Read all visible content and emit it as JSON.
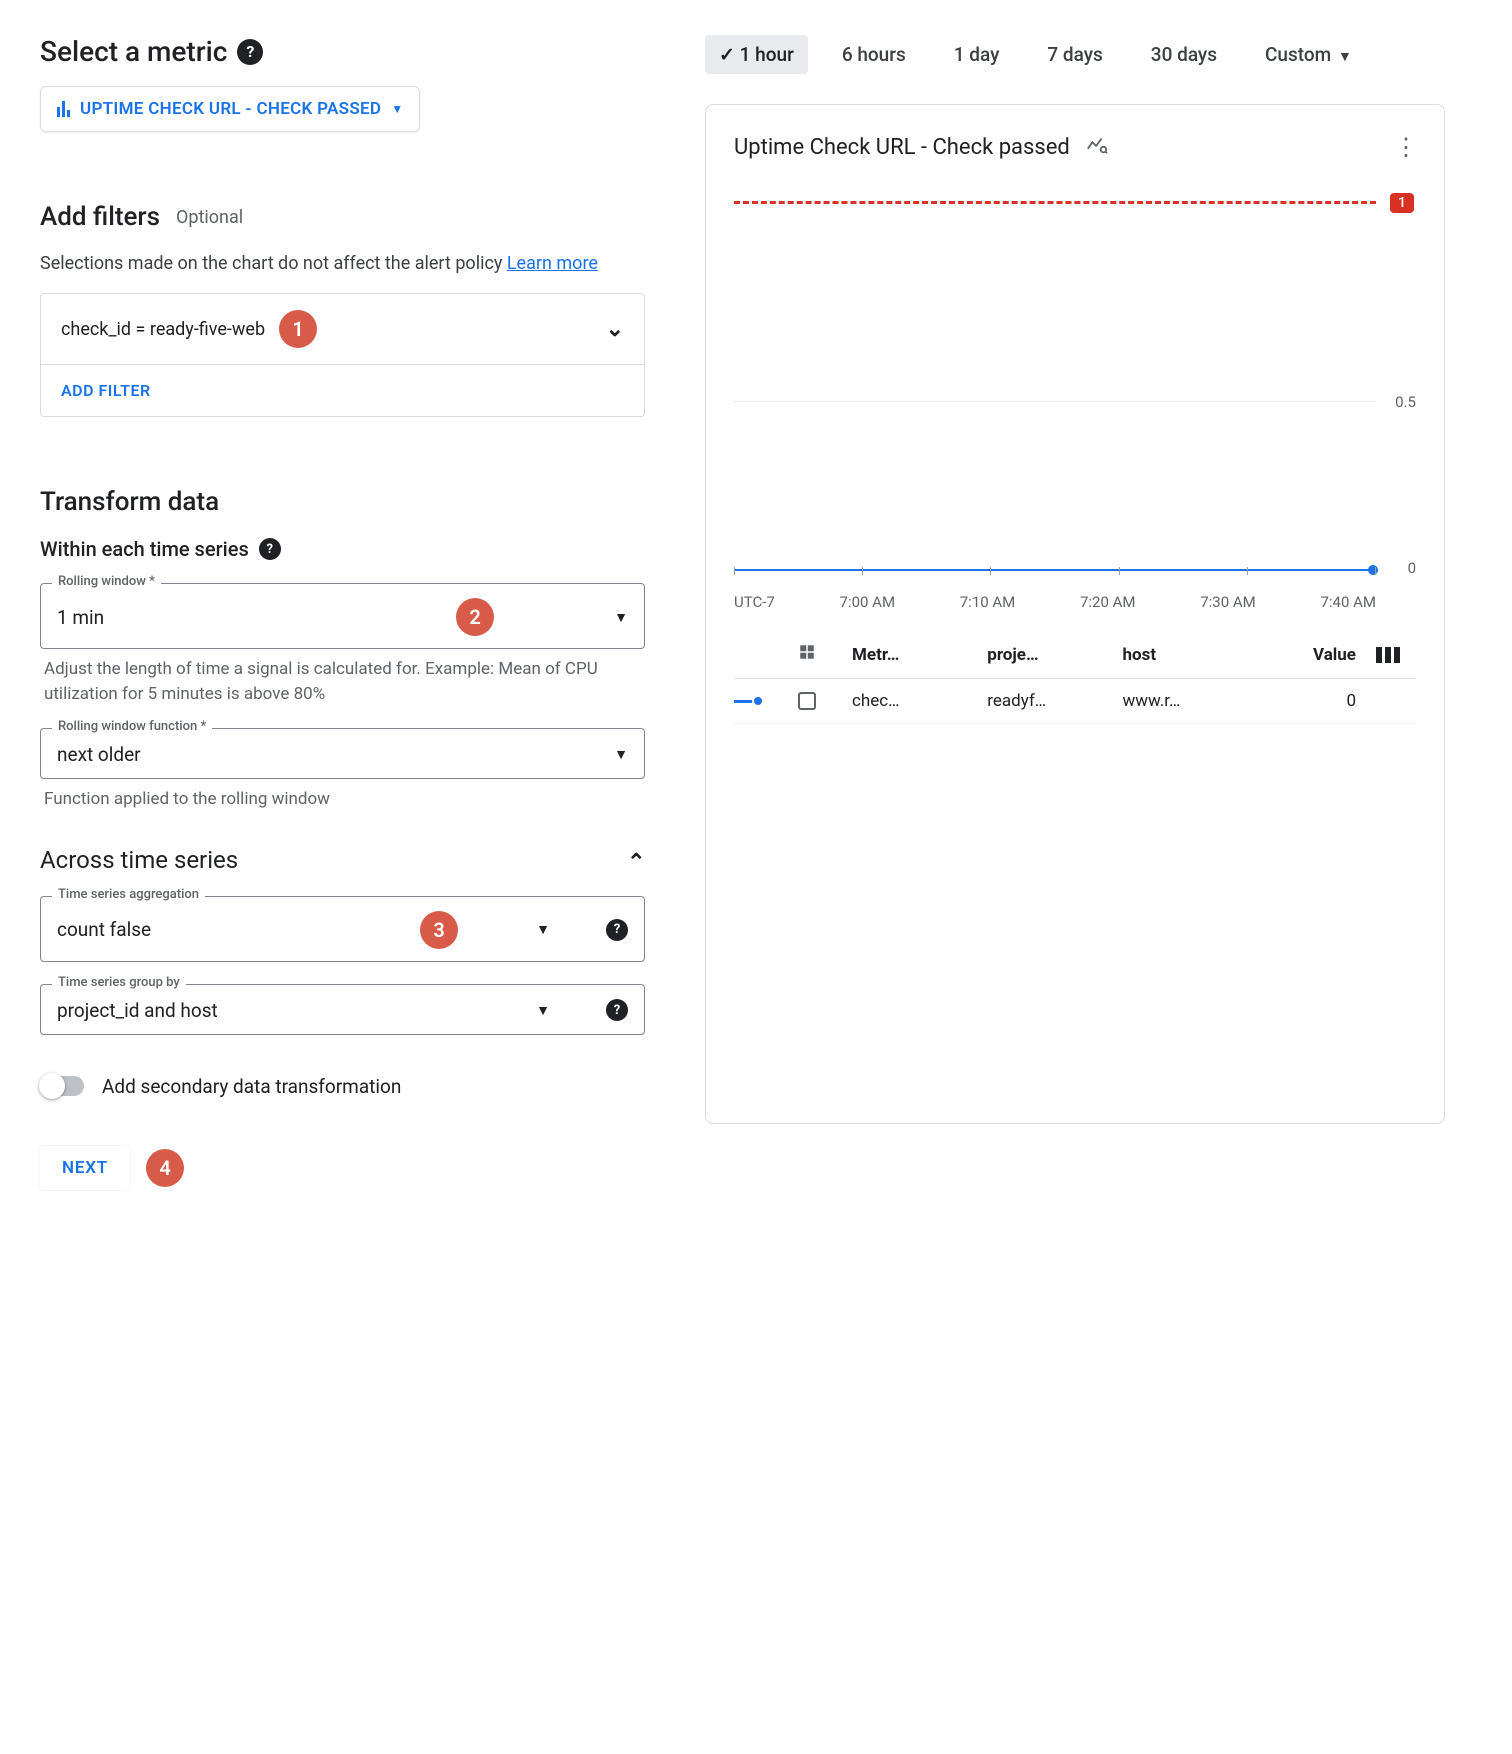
{
  "left": {
    "select_metric_title": "Select a metric",
    "metric_chip": "UPTIME CHECK URL - CHECK PASSED",
    "filters": {
      "title": "Add filters",
      "optional": "Optional",
      "hint_pre": "Selections made on the chart do not affect the alert policy ",
      "hint_link": "Learn more",
      "row_text": "check_id = ready-five-web",
      "add_filter": "ADD FILTER"
    },
    "transform_title": "Transform data",
    "within_title": "Within each time series",
    "rolling_window": {
      "label": "Rolling window *",
      "value": "1 min",
      "helper": "Adjust the length of time a signal is calculated for. Example: Mean of CPU utilization for 5 minutes is above 80%"
    },
    "rolling_fn": {
      "label": "Rolling window function *",
      "value": "next older",
      "helper": "Function applied to the rolling window"
    },
    "across_title": "Across time series",
    "aggregation": {
      "label": "Time series aggregation",
      "value": "count false"
    },
    "groupby": {
      "label": "Time series group by",
      "value": "project_id and host"
    },
    "secondary_toggle": "Add secondary data transformation",
    "next": "NEXT",
    "badges": {
      "b1": "1",
      "b2": "2",
      "b3": "3",
      "b4": "4"
    }
  },
  "right": {
    "tabs": [
      "1 hour",
      "6 hours",
      "1 day",
      "7 days",
      "30 days",
      "Custom"
    ],
    "active_tab": "1 hour",
    "chart_title": "Uptime Check URL - Check passed",
    "threshold_badge": "1",
    "axis_mid": "0.5",
    "axis_zero": "0",
    "tz": "UTC-7",
    "x_ticks": [
      "7:00 AM",
      "7:10 AM",
      "7:20 AM",
      "7:30 AM",
      "7:40 AM"
    ],
    "legend": {
      "headers": {
        "metric": "Metr…",
        "project": "proje…",
        "host": "host",
        "value": "Value"
      },
      "row": {
        "metric": "chec…",
        "project": "readyf…",
        "host": "www.r…",
        "value": "0"
      }
    }
  },
  "chart_data": {
    "type": "line",
    "title": "Uptime Check URL - Check passed",
    "ylabel": "",
    "ylim": [
      0,
      1
    ],
    "threshold": 1,
    "x": [
      "7:00 AM",
      "7:10 AM",
      "7:20 AM",
      "7:30 AM",
      "7:40 AM"
    ],
    "series": [
      {
        "name": "check_passed (project=readyf…, host=www.r…)",
        "values": [
          0,
          0,
          0,
          0,
          0
        ]
      }
    ],
    "timezone": "UTC-7"
  }
}
